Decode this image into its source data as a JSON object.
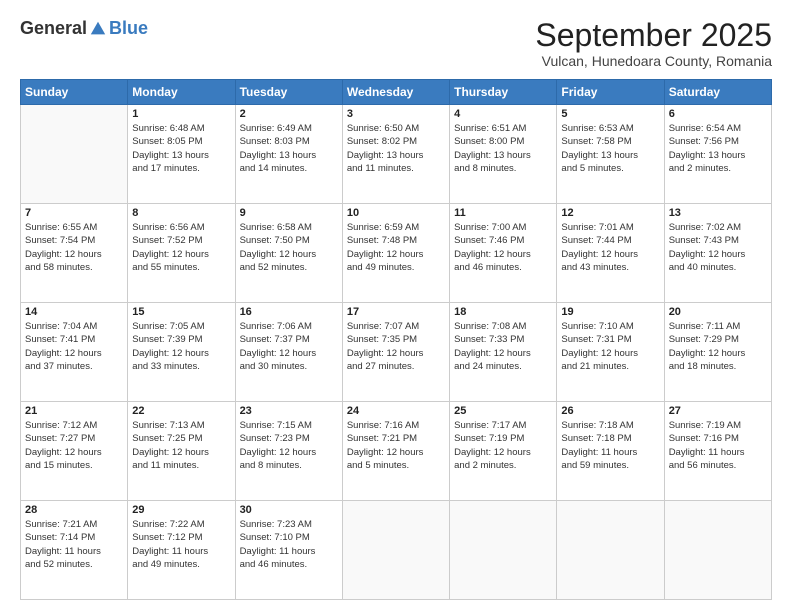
{
  "header": {
    "logo_general": "General",
    "logo_blue": "Blue",
    "month_title": "September 2025",
    "location": "Vulcan, Hunedoara County, Romania"
  },
  "days_of_week": [
    "Sunday",
    "Monday",
    "Tuesday",
    "Wednesday",
    "Thursday",
    "Friday",
    "Saturday"
  ],
  "weeks": [
    [
      {
        "day": "",
        "detail": ""
      },
      {
        "day": "1",
        "detail": "Sunrise: 6:48 AM\nSunset: 8:05 PM\nDaylight: 13 hours\nand 17 minutes."
      },
      {
        "day": "2",
        "detail": "Sunrise: 6:49 AM\nSunset: 8:03 PM\nDaylight: 13 hours\nand 14 minutes."
      },
      {
        "day": "3",
        "detail": "Sunrise: 6:50 AM\nSunset: 8:02 PM\nDaylight: 13 hours\nand 11 minutes."
      },
      {
        "day": "4",
        "detail": "Sunrise: 6:51 AM\nSunset: 8:00 PM\nDaylight: 13 hours\nand 8 minutes."
      },
      {
        "day": "5",
        "detail": "Sunrise: 6:53 AM\nSunset: 7:58 PM\nDaylight: 13 hours\nand 5 minutes."
      },
      {
        "day": "6",
        "detail": "Sunrise: 6:54 AM\nSunset: 7:56 PM\nDaylight: 13 hours\nand 2 minutes."
      }
    ],
    [
      {
        "day": "7",
        "detail": "Sunrise: 6:55 AM\nSunset: 7:54 PM\nDaylight: 12 hours\nand 58 minutes."
      },
      {
        "day": "8",
        "detail": "Sunrise: 6:56 AM\nSunset: 7:52 PM\nDaylight: 12 hours\nand 55 minutes."
      },
      {
        "day": "9",
        "detail": "Sunrise: 6:58 AM\nSunset: 7:50 PM\nDaylight: 12 hours\nand 52 minutes."
      },
      {
        "day": "10",
        "detail": "Sunrise: 6:59 AM\nSunset: 7:48 PM\nDaylight: 12 hours\nand 49 minutes."
      },
      {
        "day": "11",
        "detail": "Sunrise: 7:00 AM\nSunset: 7:46 PM\nDaylight: 12 hours\nand 46 minutes."
      },
      {
        "day": "12",
        "detail": "Sunrise: 7:01 AM\nSunset: 7:44 PM\nDaylight: 12 hours\nand 43 minutes."
      },
      {
        "day": "13",
        "detail": "Sunrise: 7:02 AM\nSunset: 7:43 PM\nDaylight: 12 hours\nand 40 minutes."
      }
    ],
    [
      {
        "day": "14",
        "detail": "Sunrise: 7:04 AM\nSunset: 7:41 PM\nDaylight: 12 hours\nand 37 minutes."
      },
      {
        "day": "15",
        "detail": "Sunrise: 7:05 AM\nSunset: 7:39 PM\nDaylight: 12 hours\nand 33 minutes."
      },
      {
        "day": "16",
        "detail": "Sunrise: 7:06 AM\nSunset: 7:37 PM\nDaylight: 12 hours\nand 30 minutes."
      },
      {
        "day": "17",
        "detail": "Sunrise: 7:07 AM\nSunset: 7:35 PM\nDaylight: 12 hours\nand 27 minutes."
      },
      {
        "day": "18",
        "detail": "Sunrise: 7:08 AM\nSunset: 7:33 PM\nDaylight: 12 hours\nand 24 minutes."
      },
      {
        "day": "19",
        "detail": "Sunrise: 7:10 AM\nSunset: 7:31 PM\nDaylight: 12 hours\nand 21 minutes."
      },
      {
        "day": "20",
        "detail": "Sunrise: 7:11 AM\nSunset: 7:29 PM\nDaylight: 12 hours\nand 18 minutes."
      }
    ],
    [
      {
        "day": "21",
        "detail": "Sunrise: 7:12 AM\nSunset: 7:27 PM\nDaylight: 12 hours\nand 15 minutes."
      },
      {
        "day": "22",
        "detail": "Sunrise: 7:13 AM\nSunset: 7:25 PM\nDaylight: 12 hours\nand 11 minutes."
      },
      {
        "day": "23",
        "detail": "Sunrise: 7:15 AM\nSunset: 7:23 PM\nDaylight: 12 hours\nand 8 minutes."
      },
      {
        "day": "24",
        "detail": "Sunrise: 7:16 AM\nSunset: 7:21 PM\nDaylight: 12 hours\nand 5 minutes."
      },
      {
        "day": "25",
        "detail": "Sunrise: 7:17 AM\nSunset: 7:19 PM\nDaylight: 12 hours\nand 2 minutes."
      },
      {
        "day": "26",
        "detail": "Sunrise: 7:18 AM\nSunset: 7:18 PM\nDaylight: 11 hours\nand 59 minutes."
      },
      {
        "day": "27",
        "detail": "Sunrise: 7:19 AM\nSunset: 7:16 PM\nDaylight: 11 hours\nand 56 minutes."
      }
    ],
    [
      {
        "day": "28",
        "detail": "Sunrise: 7:21 AM\nSunset: 7:14 PM\nDaylight: 11 hours\nand 52 minutes."
      },
      {
        "day": "29",
        "detail": "Sunrise: 7:22 AM\nSunset: 7:12 PM\nDaylight: 11 hours\nand 49 minutes."
      },
      {
        "day": "30",
        "detail": "Sunrise: 7:23 AM\nSunset: 7:10 PM\nDaylight: 11 hours\nand 46 minutes."
      },
      {
        "day": "",
        "detail": ""
      },
      {
        "day": "",
        "detail": ""
      },
      {
        "day": "",
        "detail": ""
      },
      {
        "day": "",
        "detail": ""
      }
    ]
  ]
}
